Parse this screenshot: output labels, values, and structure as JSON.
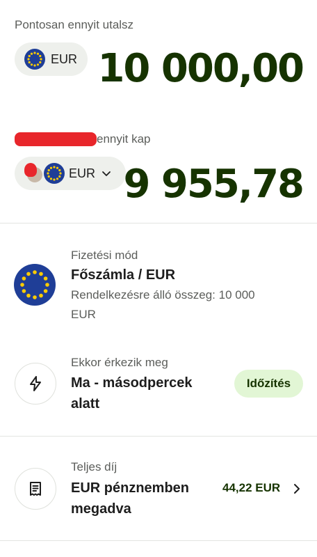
{
  "send": {
    "label": "Pontosan ennyit utalsz",
    "currency": "EUR",
    "amount": "10 000,00"
  },
  "receive": {
    "label_suffix": "ennyit kap",
    "currency": "EUR",
    "amount": "9 955,78"
  },
  "payment_method": {
    "label": "Fizetési mód",
    "title": "Főszámla / EUR",
    "subtitle": "Rendelkezésre álló összeg: 10 000 EUR"
  },
  "arrival": {
    "label": "Ekkor érkezik meg",
    "title": "Ma - másodpercek alatt",
    "badge": "Időzítés",
    "badge_bg": "#e2f6d5",
    "badge_color": "#163300"
  },
  "fee": {
    "label": "Teljes díj",
    "title": "EUR pénznemben megadva",
    "amount": "44,22 EUR"
  },
  "colors": {
    "amount": "#163300",
    "eu_blue": "#1f3e97",
    "eu_star": "#ffcc00",
    "redaction": "#e8262b"
  },
  "icons": {
    "currency_flag": "eu-flag-icon",
    "arrival": "lightning-icon",
    "fee": "receipt-icon",
    "dropdown": "chevron-down-icon",
    "fee_chevron": "chevron-right-icon"
  }
}
